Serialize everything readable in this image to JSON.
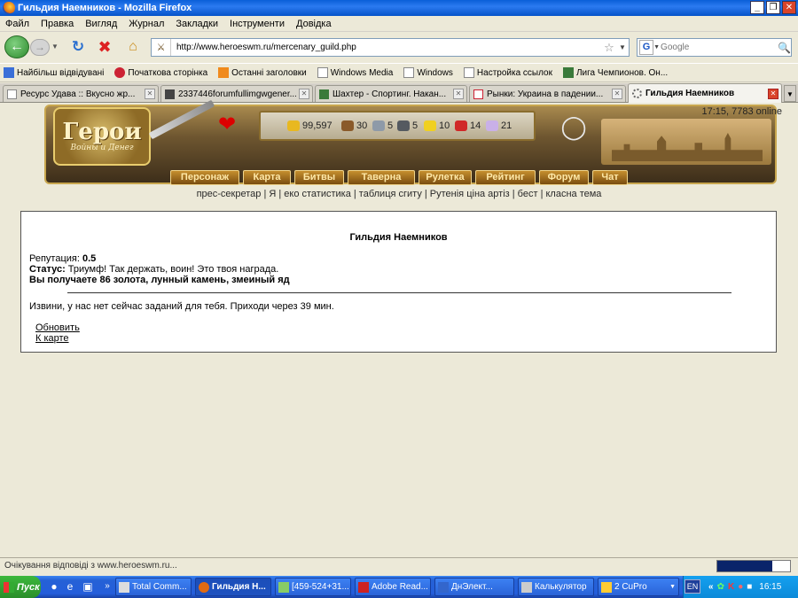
{
  "window": {
    "title": "Гильдия Наемников - Mozilla Firefox",
    "minimize": "_",
    "maximize": "❐",
    "close": "✕"
  },
  "menu": [
    "Файл",
    "Правка",
    "Вигляд",
    "Журнал",
    "Закладки",
    "Інструменти",
    "Довідка"
  ],
  "nav": {
    "url": "http://www.heroeswm.ru/mercenary_guild.php",
    "search_placeholder": "Google",
    "search_engine": "G"
  },
  "bookmarks": [
    "Найбільш відвідувані",
    "Початкова сторінка",
    "Останні заголовки",
    "Windows Media",
    "Windows",
    "Настройка ссылок",
    "Лига Чемпионов. Он..."
  ],
  "tabs": [
    {
      "label": "Ресурс Удава :: Вкусно жр..."
    },
    {
      "label": "2337446forumfullimgwgener..."
    },
    {
      "label": "Шахтер - Спортинг. Накан..."
    },
    {
      "label": "Рынки: Украина в падении..."
    },
    {
      "label": "Гильдия Наемников"
    }
  ],
  "game": {
    "logo_title": "Герои",
    "logo_subtitle": "Войны и Денег",
    "time_online": "17:15, 7783 online",
    "resources": [
      {
        "value": "99,597",
        "color": "#e8b820"
      },
      {
        "value": "30",
        "color": "#8a5a2a"
      },
      {
        "value": "5",
        "color": "#8e9aa8"
      },
      {
        "value": "5",
        "color": "#555a60"
      },
      {
        "value": "10",
        "color": "#f0d020"
      },
      {
        "value": "14",
        "color": "#d02828"
      },
      {
        "value": "21",
        "color": "#c9b0e8"
      }
    ],
    "menu": [
      "Персонаж",
      "Карта",
      "Битвы",
      "Таверна",
      "Рулетка",
      "Рейтинг",
      "Форум",
      "Чат"
    ],
    "sublinks": "прес-секретар | Я | еко статистика | таблиця сгиту | Рутенія   ціна артіз | бест | класна тема"
  },
  "page": {
    "title": "Гильдия Наемников",
    "reputation_label": "Репутация:",
    "reputation_value": "0.5",
    "status_label": "Статус:",
    "status_text": "Триумф! Так держать, воин! Это твоя награда.",
    "reward": "Вы получаете 86 золота, лунный камень, змеиный яд",
    "message": "Извини, у нас нет сейчас заданий для тебя. Приходи через 39 мин.",
    "link_refresh": "Обновить",
    "link_map": "К карте"
  },
  "status_bar": {
    "text": "Очікування відповіді з www.heroeswm.ru...",
    "progress": 0.75
  },
  "taskbar": {
    "start": "Пуск",
    "tasks": [
      "Total Comm...",
      "Гильдия Н...",
      "[459-524+31...",
      "Adobe Read...",
      "ДнЭлект...",
      "Калькулятор",
      "2 CuPro"
    ],
    "lang": "EN",
    "clock": "16:15"
  }
}
